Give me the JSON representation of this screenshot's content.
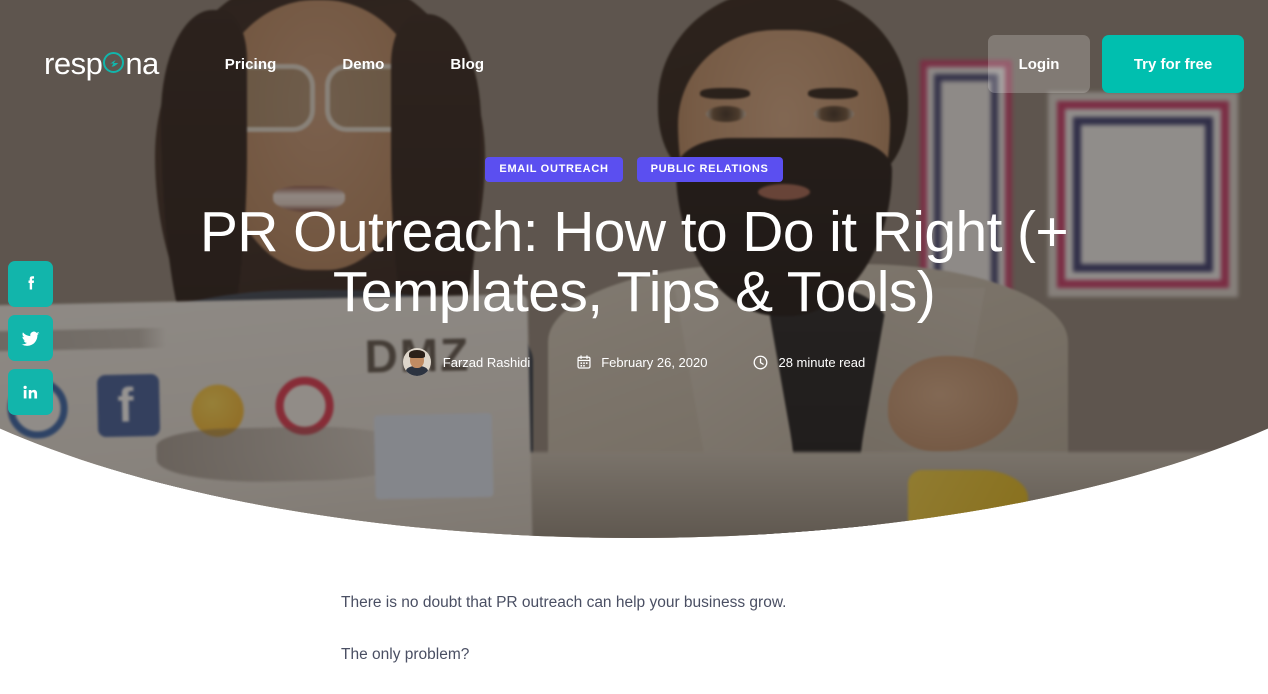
{
  "brand": {
    "logo_text_before": "resp",
    "logo_text_after": "na",
    "logo_full": "respona",
    "accent_teal": "#00bfaf",
    "accent_purple": "#5b4ff0",
    "social_teal": "#12b5ab"
  },
  "nav": {
    "links": [
      {
        "label": "Pricing",
        "name": "nav-link-pricing"
      },
      {
        "label": "Demo",
        "name": "nav-link-demo"
      },
      {
        "label": "Blog",
        "name": "nav-link-blog"
      }
    ],
    "login_label": "Login",
    "try_label": "Try for free"
  },
  "hero": {
    "tags": [
      {
        "label": "Email Outreach"
      },
      {
        "label": "Public Relations"
      }
    ],
    "title": "PR Outreach: How to Do it Right (+ Templates, Tips & Tools)",
    "meta": {
      "author": "Farzad Rashidi",
      "date": "February 26, 2020",
      "read_time": "28 minute read",
      "date_icon": "calendar-icon",
      "read_icon": "clock-icon",
      "avatar_icon": "author-avatar"
    }
  },
  "social": {
    "items": [
      {
        "network": "Facebook",
        "icon": "facebook-icon"
      },
      {
        "network": "Twitter",
        "icon": "twitter-icon"
      },
      {
        "network": "LinkedIn",
        "icon": "linkedin-icon"
      }
    ]
  },
  "article": {
    "paragraphs": [
      "There is no doubt that PR outreach can help your business grow.",
      "The only problem?"
    ]
  }
}
